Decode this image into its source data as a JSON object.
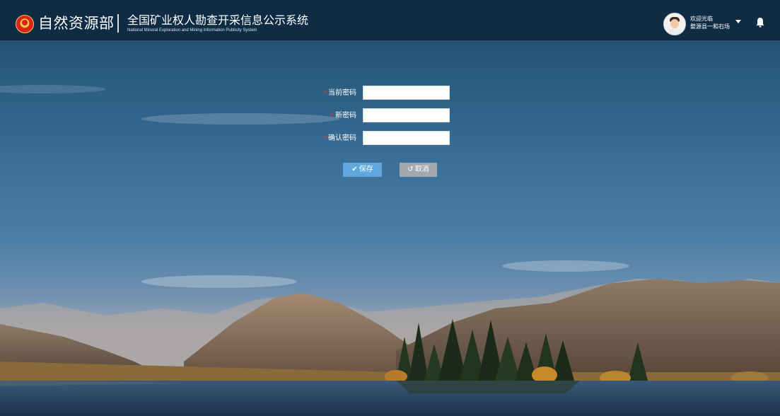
{
  "header": {
    "brand": "自然资源部",
    "system_title": "全国矿业权人勘查开采信息公示系统",
    "system_subtitle": "National Mineral Exploration and Mining Information Publicity System",
    "welcome": "欢迎光临",
    "user_name": "婺源县一和石场"
  },
  "form": {
    "required_mark": "*",
    "current_password_label": "当前密码",
    "current_password_value": "",
    "new_password_label": "新密码",
    "new_password_value": "",
    "confirm_password_label": "确认密码",
    "confirm_password_value": "",
    "save_label": "保存",
    "cancel_label": "取消"
  },
  "icons": {
    "logo": "national-emblem-icon",
    "avatar": "user-avatar-icon",
    "dropdown": "caret-down-icon",
    "notifications": "bell-icon",
    "save": "check-icon",
    "cancel": "undo-icon"
  },
  "colors": {
    "header_bg": "#0f2c44",
    "save_button": "#5fa7dd",
    "cancel_button": "#a5a8ab",
    "required_mark": "#e0393e"
  }
}
